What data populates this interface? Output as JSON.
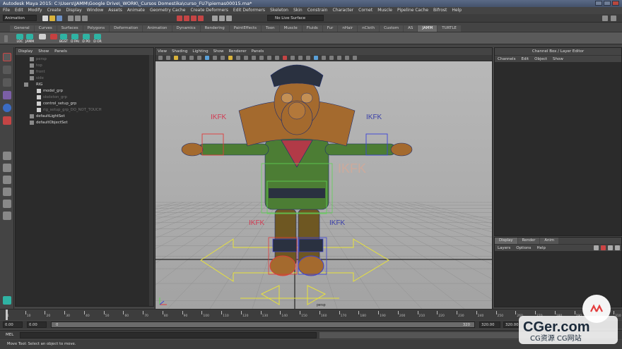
{
  "window": {
    "title": "Autodesk Maya 2015: C:\\Users\\JAMM\\Google Drive\\_WORK\\_Cursos Domestika\\curso_FU7\\piernas00015.ma*"
  },
  "menu": [
    "File",
    "Edit",
    "Modify",
    "Create",
    "Display",
    "Window",
    "Assets",
    "Animate",
    "Geometry Cache",
    "Create Deformers",
    "Edit Deformers",
    "Skeleton",
    "Skin",
    "Constrain",
    "Character",
    "Cornet",
    "Muscle",
    "Pipeline Cache",
    "Bifrost",
    "Help"
  ],
  "status_line": {
    "mode": "Animation",
    "input_field": "No Live Surface"
  },
  "shelf": {
    "tabs": [
      "General",
      "Curves",
      "Surfaces",
      "Polygons",
      "Deformation",
      "Animation",
      "Dynamics",
      "Rendering",
      "PaintEffects",
      "Toon",
      "Muscle",
      "Fluids",
      "Fur",
      "nHair",
      "nCloth",
      "Custom",
      "AS",
      "JAMM",
      "TURTLE"
    ],
    "active_tab": "JAMM",
    "buttons": [
      "LOC",
      "JAMM",
      "",
      "",
      "",
      "",
      "BGST",
      "D PAI",
      "D PO",
      "D OR"
    ]
  },
  "outliner": {
    "menu": [
      "Display",
      "Show",
      "Panels"
    ],
    "items": [
      {
        "label": "persp",
        "dim": true,
        "indent": 0
      },
      {
        "label": "top",
        "dim": true,
        "indent": 0
      },
      {
        "label": "front",
        "dim": true,
        "indent": 0
      },
      {
        "label": "side",
        "dim": true,
        "indent": 0
      },
      {
        "label": "RIG",
        "dim": false,
        "indent": 0
      },
      {
        "label": "model_grp",
        "dim": false,
        "indent": 1
      },
      {
        "label": "skeleton_grp",
        "dim": true,
        "indent": 1
      },
      {
        "label": "control_setup_grp",
        "dim": false,
        "indent": 1
      },
      {
        "label": "rig_setup_grp_DO_NOT_TOUCH",
        "dim": true,
        "indent": 1
      },
      {
        "label": "defaultLightSet",
        "dim": false,
        "indent": 0
      },
      {
        "label": "defaultObjectSet",
        "dim": false,
        "indent": 0
      }
    ]
  },
  "viewport": {
    "menu": [
      "View",
      "Shading",
      "Lighting",
      "Show",
      "Renderer",
      "Panels"
    ],
    "camera_label": "persp",
    "labels": [
      {
        "text": "IKFK",
        "color": "#d23a52"
      },
      {
        "text": "IKFK",
        "color": "#3a3fa8"
      },
      {
        "text": "IKFK",
        "color": "#d9a894"
      },
      {
        "text": "IKFK",
        "color": "#d23a52"
      },
      {
        "text": "IKFK",
        "color": "#3a3fa8"
      }
    ],
    "colors": {
      "background_top": "#b8b8b8",
      "skin": "#a46a2e",
      "wire": "#1c2b6e",
      "shirt": "#4c7d34",
      "scarf": "#b23a47",
      "pants": "#6e5722",
      "hat": "#2a3140",
      "ctrl_yellow": "#e8e23b",
      "ctrl_red": "#e03b3b",
      "ctrl_blue": "#3b42d8",
      "ctrl_green": "#5fd455"
    }
  },
  "channel_box": {
    "title": "Channel Box / Layer Editor",
    "menu": [
      "Channels",
      "Edit",
      "Object",
      "Show"
    ]
  },
  "layer_editor": {
    "tabs": [
      "Display",
      "Render",
      "Anim"
    ],
    "active_tab": "Display",
    "menu": [
      "Layers",
      "Options",
      "Help"
    ]
  },
  "time_slider": {
    "ticks": [
      "1",
      "10",
      "20",
      "30",
      "40",
      "50",
      "60",
      "70",
      "80",
      "90",
      "100",
      "110",
      "120",
      "130",
      "140",
      "150",
      "160",
      "170",
      "180",
      "190",
      "200",
      "210",
      "220",
      "230",
      "240",
      "250",
      "260",
      "270",
      "280",
      "290",
      "300",
      "310"
    ]
  },
  "range_slider": {
    "start": "0.00",
    "start_inner": "0.00",
    "slider_start": "0",
    "slider_end": "320",
    "end_inner": "320.00",
    "end": "320.00"
  },
  "command_line": {
    "label": "MEL"
  },
  "help_line": {
    "text": "Move Tool: Select an object to move."
  },
  "watermark": {
    "brand": "CGer.com",
    "subtitle": "CG资源 CG网站"
  }
}
